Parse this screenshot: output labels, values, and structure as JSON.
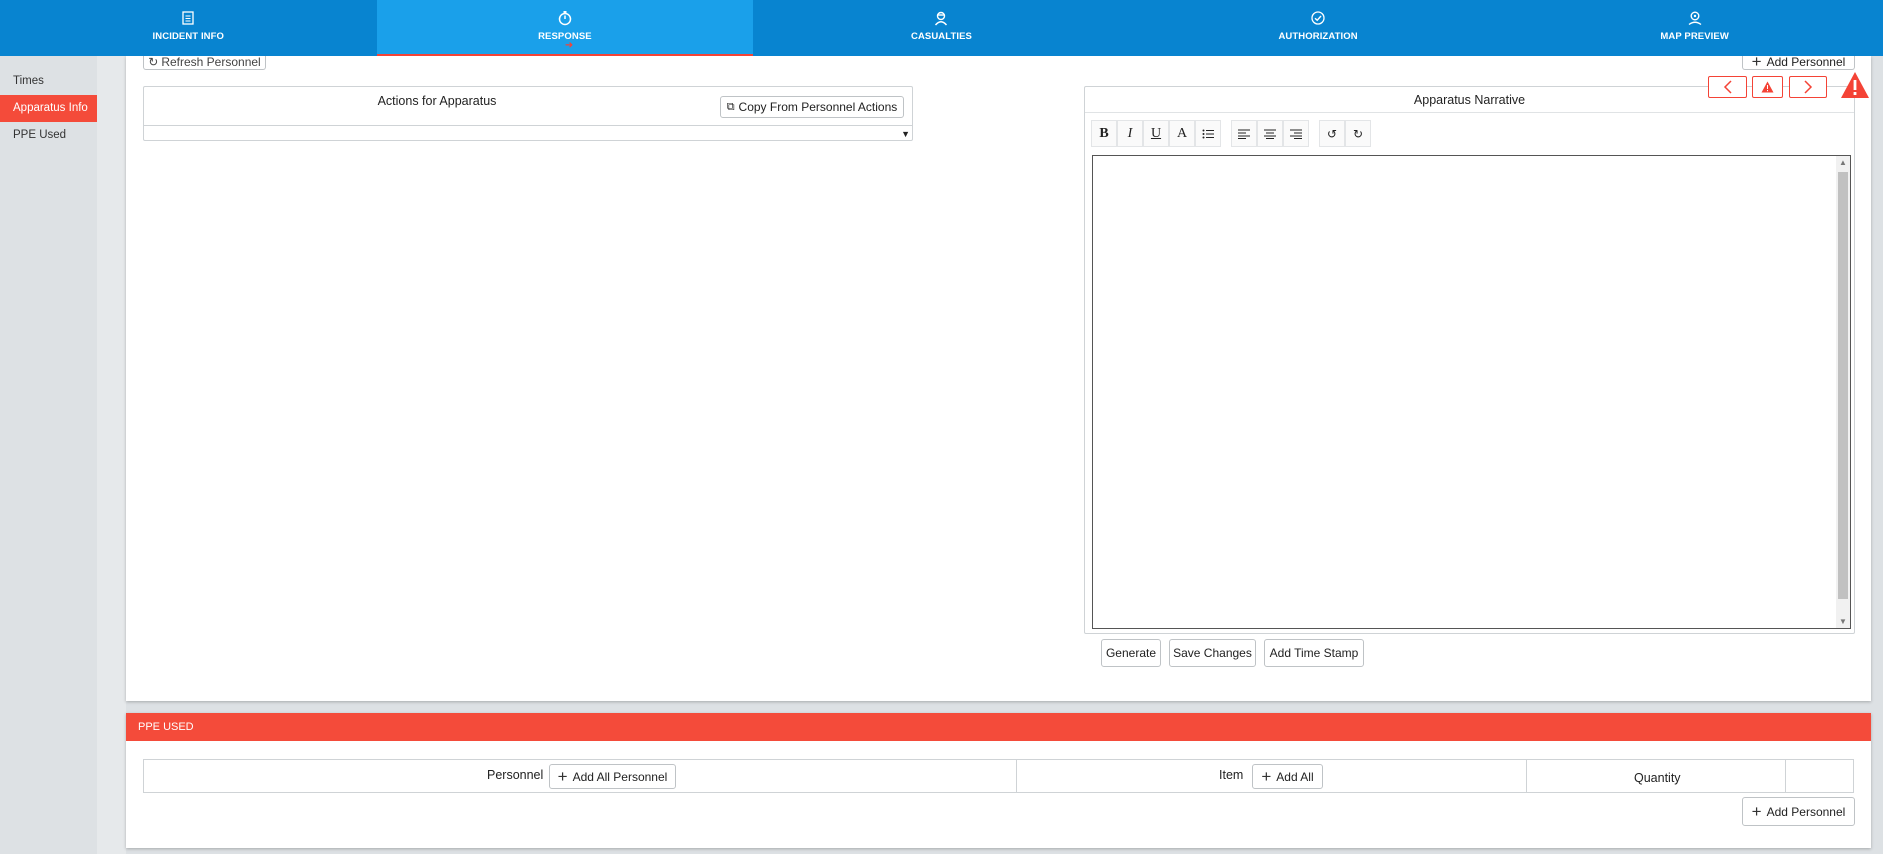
{
  "nav": {
    "tabs": [
      {
        "label": "INCIDENT INFO",
        "icon": "clipboard-icon"
      },
      {
        "label": "RESPONSE",
        "icon": "stopwatch-icon"
      },
      {
        "label": "CASUALTIES",
        "icon": "person-icon"
      },
      {
        "label": "AUTHORIZATION",
        "icon": "check-circle-icon"
      },
      {
        "label": "MAP PREVIEW",
        "icon": "map-pin-icon"
      }
    ],
    "active_index": 1
  },
  "sidebar": {
    "items": [
      {
        "label": "Times"
      },
      {
        "label": "Apparatus Info"
      },
      {
        "label": "PPE Used"
      }
    ],
    "active_index": 1
  },
  "apparatus": {
    "refresh_label": "Refresh Personnel",
    "add_personnel_label": "Add Personnel",
    "actions_title": "Actions for Apparatus",
    "copy_label": "Copy From Personnel Actions",
    "narrative_title": "Apparatus Narrative",
    "toolbar": [
      "B",
      "I",
      "U",
      "A",
      "list",
      "align-left",
      "align-center",
      "align-right",
      "undo",
      "redo"
    ],
    "narrative_text": "",
    "generate_label": "Generate",
    "save_label": "Save Changes",
    "timestamp_label": "Add Time Stamp"
  },
  "ppe": {
    "header": "PPE USED",
    "columns": {
      "personnel": "Personnel",
      "add_all_personnel": "Add All Personnel",
      "item": "Item",
      "add_all": "Add All",
      "quantity": "Quantity"
    },
    "add_personnel_label": "Add Personnel"
  },
  "colors": {
    "nav_bg": "#0884d0",
    "nav_active": "#1aa0ea",
    "accent_red": "#f44b3a"
  }
}
